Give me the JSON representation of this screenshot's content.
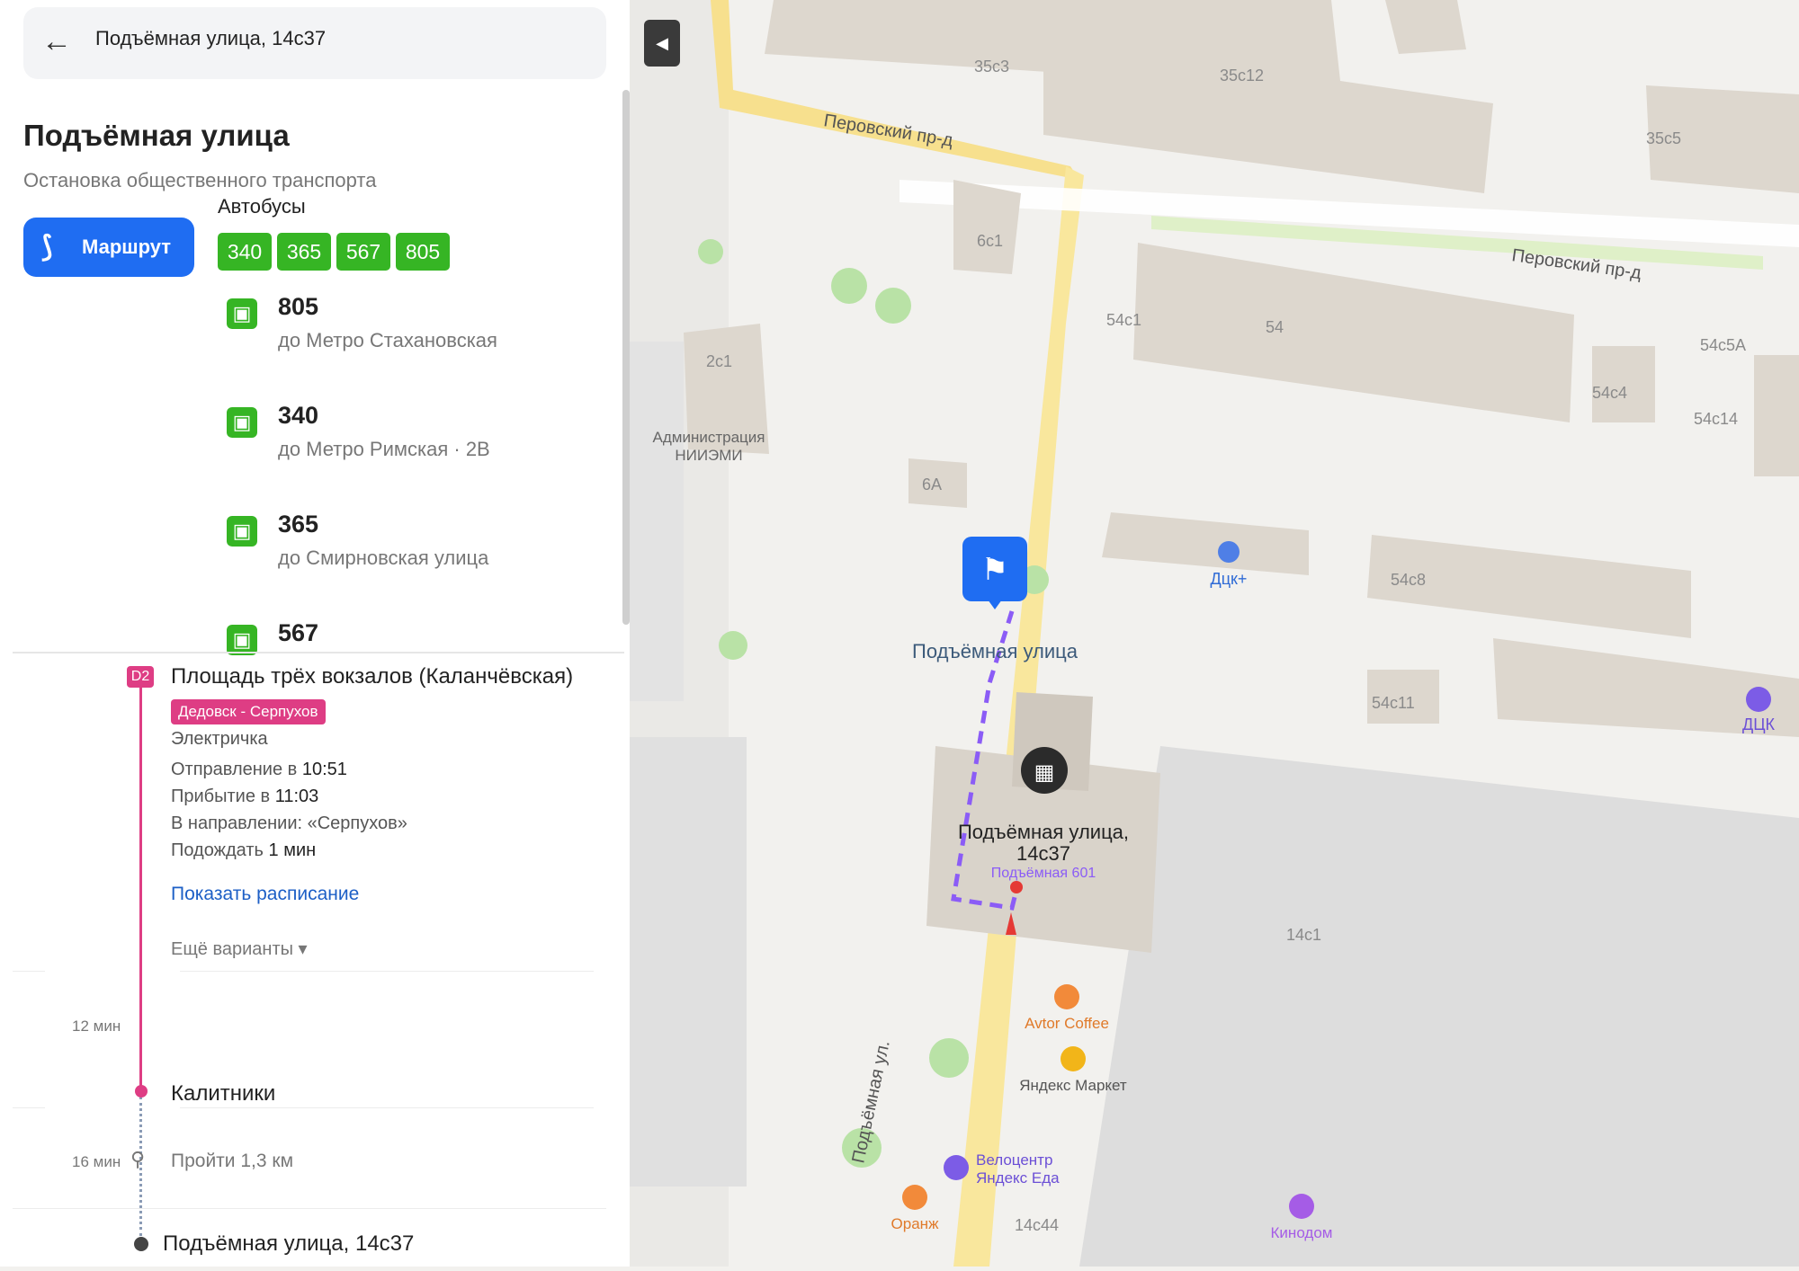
{
  "search": {
    "value": "Подъёмная улица, 14с37"
  },
  "place": {
    "title": "Подъёмная улица",
    "subtitle": "Остановка общественного транспорта",
    "route_button": "Маршрут",
    "buses_heading": "Автобусы",
    "chips": [
      "340",
      "365",
      "567",
      "805"
    ],
    "buses": [
      {
        "number": "805",
        "destination": "до Метро Стахановская"
      },
      {
        "number": "340",
        "destination": "до Метро Римская · 2В"
      },
      {
        "number": "365",
        "destination": "до Смирновская улица"
      },
      {
        "number": "567",
        "destination": ""
      }
    ]
  },
  "route": {
    "line_badge": "D2",
    "station": "Площадь трёх вокзалов (Каланчёвская)",
    "train_badge": "Дедовск - Серпухов",
    "train_type": "Электричка",
    "departure_label": "Отправление в",
    "departure_time": "10:51",
    "arrival_label": "Прибытие в",
    "arrival_time": "11:03",
    "direction": "В направлении: «Серпухов»",
    "wait_label": "Подождать",
    "wait_time": "1 мин",
    "show_schedule": "Показать расписание",
    "more_options": "Ещё варианты ▾",
    "ride_duration": "12 мин",
    "transfer_station": "Калитники",
    "walk_duration": "16 мин",
    "walk_text": "Пройти 1,3 км",
    "destination": "Подъёмная улица, 14с37"
  },
  "map": {
    "labels": {
      "b35c3": "35с3",
      "b35c12": "35с12",
      "b35c5": "35с5",
      "street_perovsky_1": "Перовский пр-д",
      "street_perovsky_2": "Перовский пр-д",
      "b6c1": "6с1",
      "b2c1": "2с1",
      "b54c1": "54с1",
      "b54": "54",
      "b54c5a": "54с5А",
      "b54c4": "54с4",
      "b54c14": "54с14",
      "admin": "Администрация",
      "niiemi": "НИИЭМИ",
      "b6a": "6А",
      "dck_plus": "Дцк+",
      "b54c8": "54с8",
      "stop_label": "Подъёмная улица",
      "b54c11": "54с11",
      "dck": "ДЦК",
      "addr_line1": "Подъёмная улица,",
      "addr_line2": "14с37",
      "podemnaya601": "Подъёмная 601",
      "b14c1": "14с1",
      "avtor": "Avtor Coffee",
      "yamarket": "Яндекс Маркет",
      "velo1": "Велоцентр",
      "velo2": "Яндекс Еда",
      "street_podemnaya": "Подъёмная ул.",
      "oranzh": "Оранж",
      "b14c44": "14с44",
      "kinodom": "Кинодом"
    },
    "colors": {
      "road_yellow": "#f9e79d",
      "route_purple": "#8b5cf6",
      "building": "#ddd7ce",
      "bus_blue": "#1f6df2"
    }
  }
}
